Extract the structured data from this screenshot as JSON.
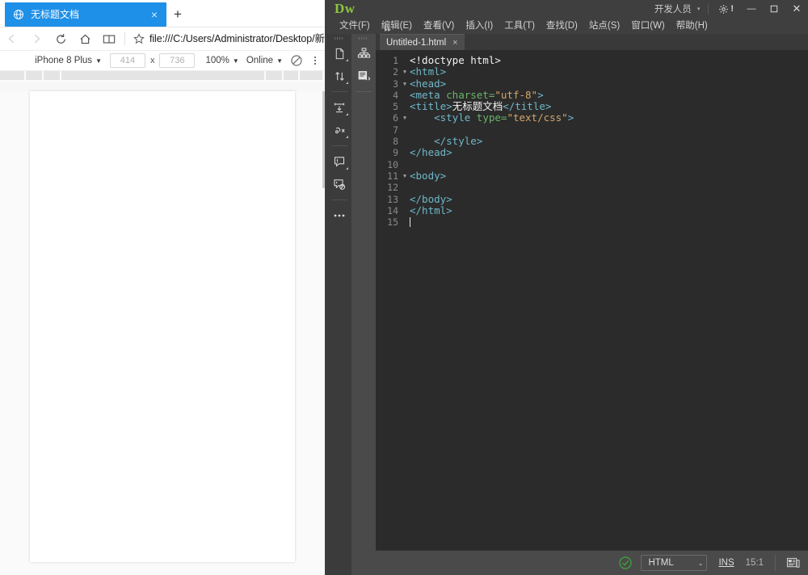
{
  "browser": {
    "tab": {
      "title": "无标题文档",
      "favicon_icon": "globe-icon",
      "close_icon": "×"
    },
    "new_tab_label": "+",
    "nav": {
      "back_icon": "‹",
      "forward_icon": "›",
      "refresh_icon": "refresh-icon",
      "home_icon": "home-icon",
      "reading_view_icon": "book-icon",
      "star_icon": "star-icon",
      "url": "file:///C:/Users/Administrator/Desktop/新"
    },
    "device_toolbar": {
      "device": "iPhone 8 Plus",
      "width": "414",
      "height": "736",
      "separator": "x",
      "zoom": "100%",
      "network": "Online",
      "throttle_icon": "no-throttle-icon",
      "more_icon": "kebab-menu-icon",
      "caret": "▼"
    }
  },
  "dreamweaver": {
    "title": {
      "logo": "Dw",
      "workspace": "开发人员",
      "workspace_caret": "▾",
      "gear_icon": "gear-icon",
      "gear_badge": "!",
      "minimize": "—",
      "maximize": "❐",
      "close": "✕"
    },
    "menus": [
      {
        "label": "文件(F)"
      },
      {
        "label": "编辑(E)"
      },
      {
        "label": "查看(V)"
      },
      {
        "label": "插入(I)"
      },
      {
        "label": "工具(T)"
      },
      {
        "label": "查找(D)"
      },
      {
        "label": "站点(S)"
      },
      {
        "label": "窗口(W)"
      },
      {
        "label": "帮助(H)"
      }
    ],
    "left_toolbar": [
      {
        "name": "open-documents-icon"
      },
      {
        "name": "file-management-icon"
      },
      {
        "name": "format-source-code-icon"
      },
      {
        "name": "apply-comment-icon"
      },
      {
        "name": "remove-comment-icon"
      },
      {
        "name": "highlight-changes-icon"
      },
      {
        "name": "more-tools-icon"
      }
    ],
    "right_toolbar": [
      {
        "name": "dom-tree-icon"
      },
      {
        "name": "code-view-icon"
      }
    ],
    "collapse_arrows": "▸▸",
    "doc_tab": {
      "label": "Untitled-1.html",
      "close_icon": "×"
    },
    "code": {
      "lines": [
        {
          "num": "1",
          "fold": "",
          "indent": 0,
          "tokens": [
            {
              "t": "txt",
              "s": "<!doctype html>"
            }
          ]
        },
        {
          "num": "2",
          "fold": "▼",
          "indent": 0,
          "tokens": [
            {
              "t": "tag",
              "s": "<html>"
            }
          ]
        },
        {
          "num": "3",
          "fold": "▼",
          "indent": 0,
          "tokens": [
            {
              "t": "tag",
              "s": "<head>"
            }
          ]
        },
        {
          "num": "4",
          "fold": "",
          "indent": 0,
          "tokens": [
            {
              "t": "tag",
              "s": "<meta "
            },
            {
              "t": "attr",
              "s": "charset="
            },
            {
              "t": "val",
              "s": "\"utf-8\""
            },
            {
              "t": "tag",
              "s": ">"
            }
          ]
        },
        {
          "num": "5",
          "fold": "",
          "indent": 0,
          "tokens": [
            {
              "t": "tag",
              "s": "<title>"
            },
            {
              "t": "txt",
              "s": "无标题文档"
            },
            {
              "t": "tag",
              "s": "</title>"
            }
          ]
        },
        {
          "num": "6",
          "fold": "▼",
          "indent": 1,
          "tokens": [
            {
              "t": "tag",
              "s": "<style "
            },
            {
              "t": "attr",
              "s": "type="
            },
            {
              "t": "val",
              "s": "\"text/css\""
            },
            {
              "t": "tag",
              "s": ">"
            }
          ]
        },
        {
          "num": "7",
          "fold": "",
          "indent": 0,
          "tokens": []
        },
        {
          "num": "8",
          "fold": "",
          "indent": 1,
          "tokens": [
            {
              "t": "tag",
              "s": "</style>"
            }
          ]
        },
        {
          "num": "9",
          "fold": "",
          "indent": 0,
          "tokens": [
            {
              "t": "tag",
              "s": "</head>"
            }
          ]
        },
        {
          "num": "10",
          "fold": "",
          "indent": 0,
          "tokens": []
        },
        {
          "num": "11",
          "fold": "▼",
          "indent": 0,
          "tokens": [
            {
              "t": "tag",
              "s": "<body>"
            }
          ]
        },
        {
          "num": "12",
          "fold": "",
          "indent": 0,
          "tokens": []
        },
        {
          "num": "13",
          "fold": "",
          "indent": 0,
          "tokens": [
            {
              "t": "tag",
              "s": "</body>"
            }
          ]
        },
        {
          "num": "14",
          "fold": "",
          "indent": 0,
          "tokens": [
            {
              "t": "tag",
              "s": "</html>"
            }
          ]
        },
        {
          "num": "15",
          "fold": "",
          "indent": 0,
          "tokens": [],
          "caret": true
        }
      ]
    },
    "status": {
      "validation_icon": "green-check-icon",
      "doc_type": "HTML",
      "doc_type_caret": "⌄",
      "insert_mode": "INS",
      "cursor_position": "15:1",
      "panel_icon": "properties-panel-icon"
    }
  },
  "colors": {
    "browser_tab_active": "#1e90e8",
    "dw_logo_green": "#8cc63f",
    "code_tag": "#6fb8c9",
    "code_attr": "#69b369",
    "code_value": "#d5a66b",
    "editor_bg": "#2b2b2b",
    "status_ok_green": "#3f9a3f"
  }
}
